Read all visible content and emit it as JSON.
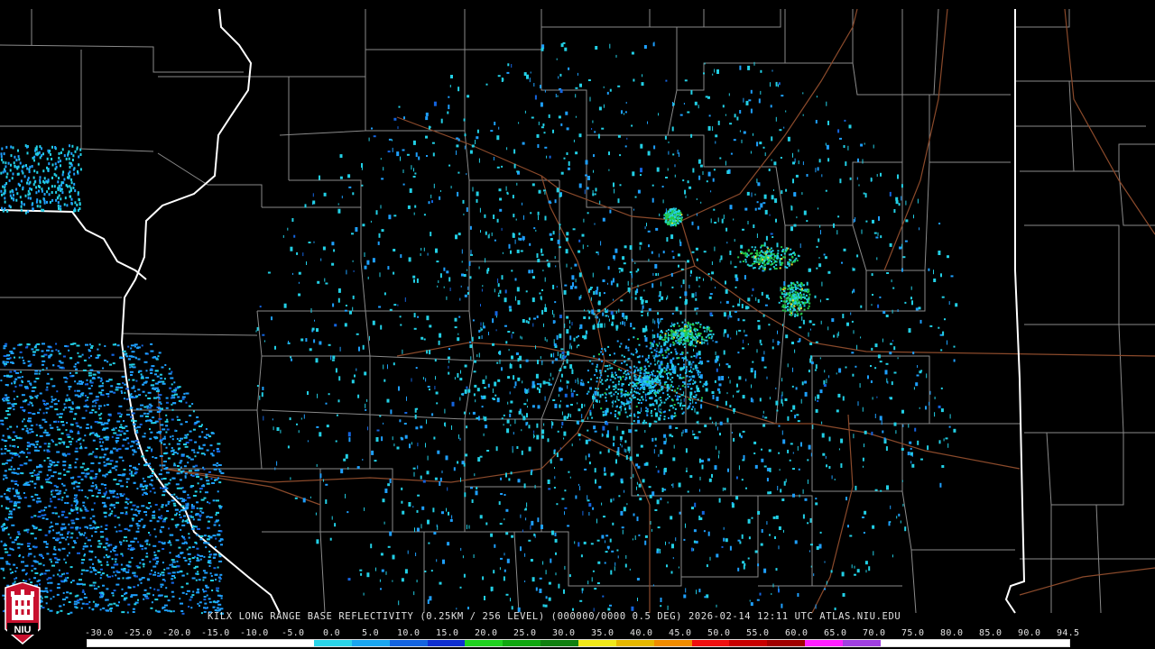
{
  "caption": "KILX LONG RANGE BASE REFLECTIVITY (0.25KM / 256 LEVEL) (000000/0000 0.5 DEG) 2026-02-14 12:11 UTC  ATLAS.NIU.EDU",
  "logo_text": "NIU",
  "scale": {
    "labels": [
      "-30.0",
      "-25.0",
      "-20.0",
      "-15.0",
      "-10.0",
      "-5.0",
      "0.0",
      "5.0",
      "10.0",
      "15.0",
      "20.0",
      "25.0",
      "30.0",
      "35.0",
      "40.0",
      "45.0",
      "50.0",
      "55.0",
      "60.0",
      "65.0",
      "70.0",
      "75.0",
      "80.0",
      "85.0",
      "90.0",
      "94.5"
    ],
    "colors": [
      "#ffffff",
      "#ffffff",
      "#ffffff",
      "#ffffff",
      "#ffffff",
      "#ffffff",
      "#2ad4e8",
      "#1aa6f0",
      "#1464e0",
      "#0f2fd0",
      "#1fd21f",
      "#10a810",
      "#108010",
      "#f0e81a",
      "#e6b800",
      "#f08c00",
      "#f01010",
      "#c80000",
      "#a00000",
      "#ff20ff",
      "#a040e0",
      "#ffffff",
      "#ffffff",
      "#ffffff",
      "#ffffff",
      "#ffffff"
    ]
  },
  "colors": {
    "state_border": "#ffffff",
    "county_line": "#8a8a8a",
    "highway": "#8b4a2b",
    "echo_light": "#1ea0ff",
    "echo_cyan": "#22d0e6",
    "echo_green": "#22c94a",
    "echo_yellow": "#e8e030"
  }
}
